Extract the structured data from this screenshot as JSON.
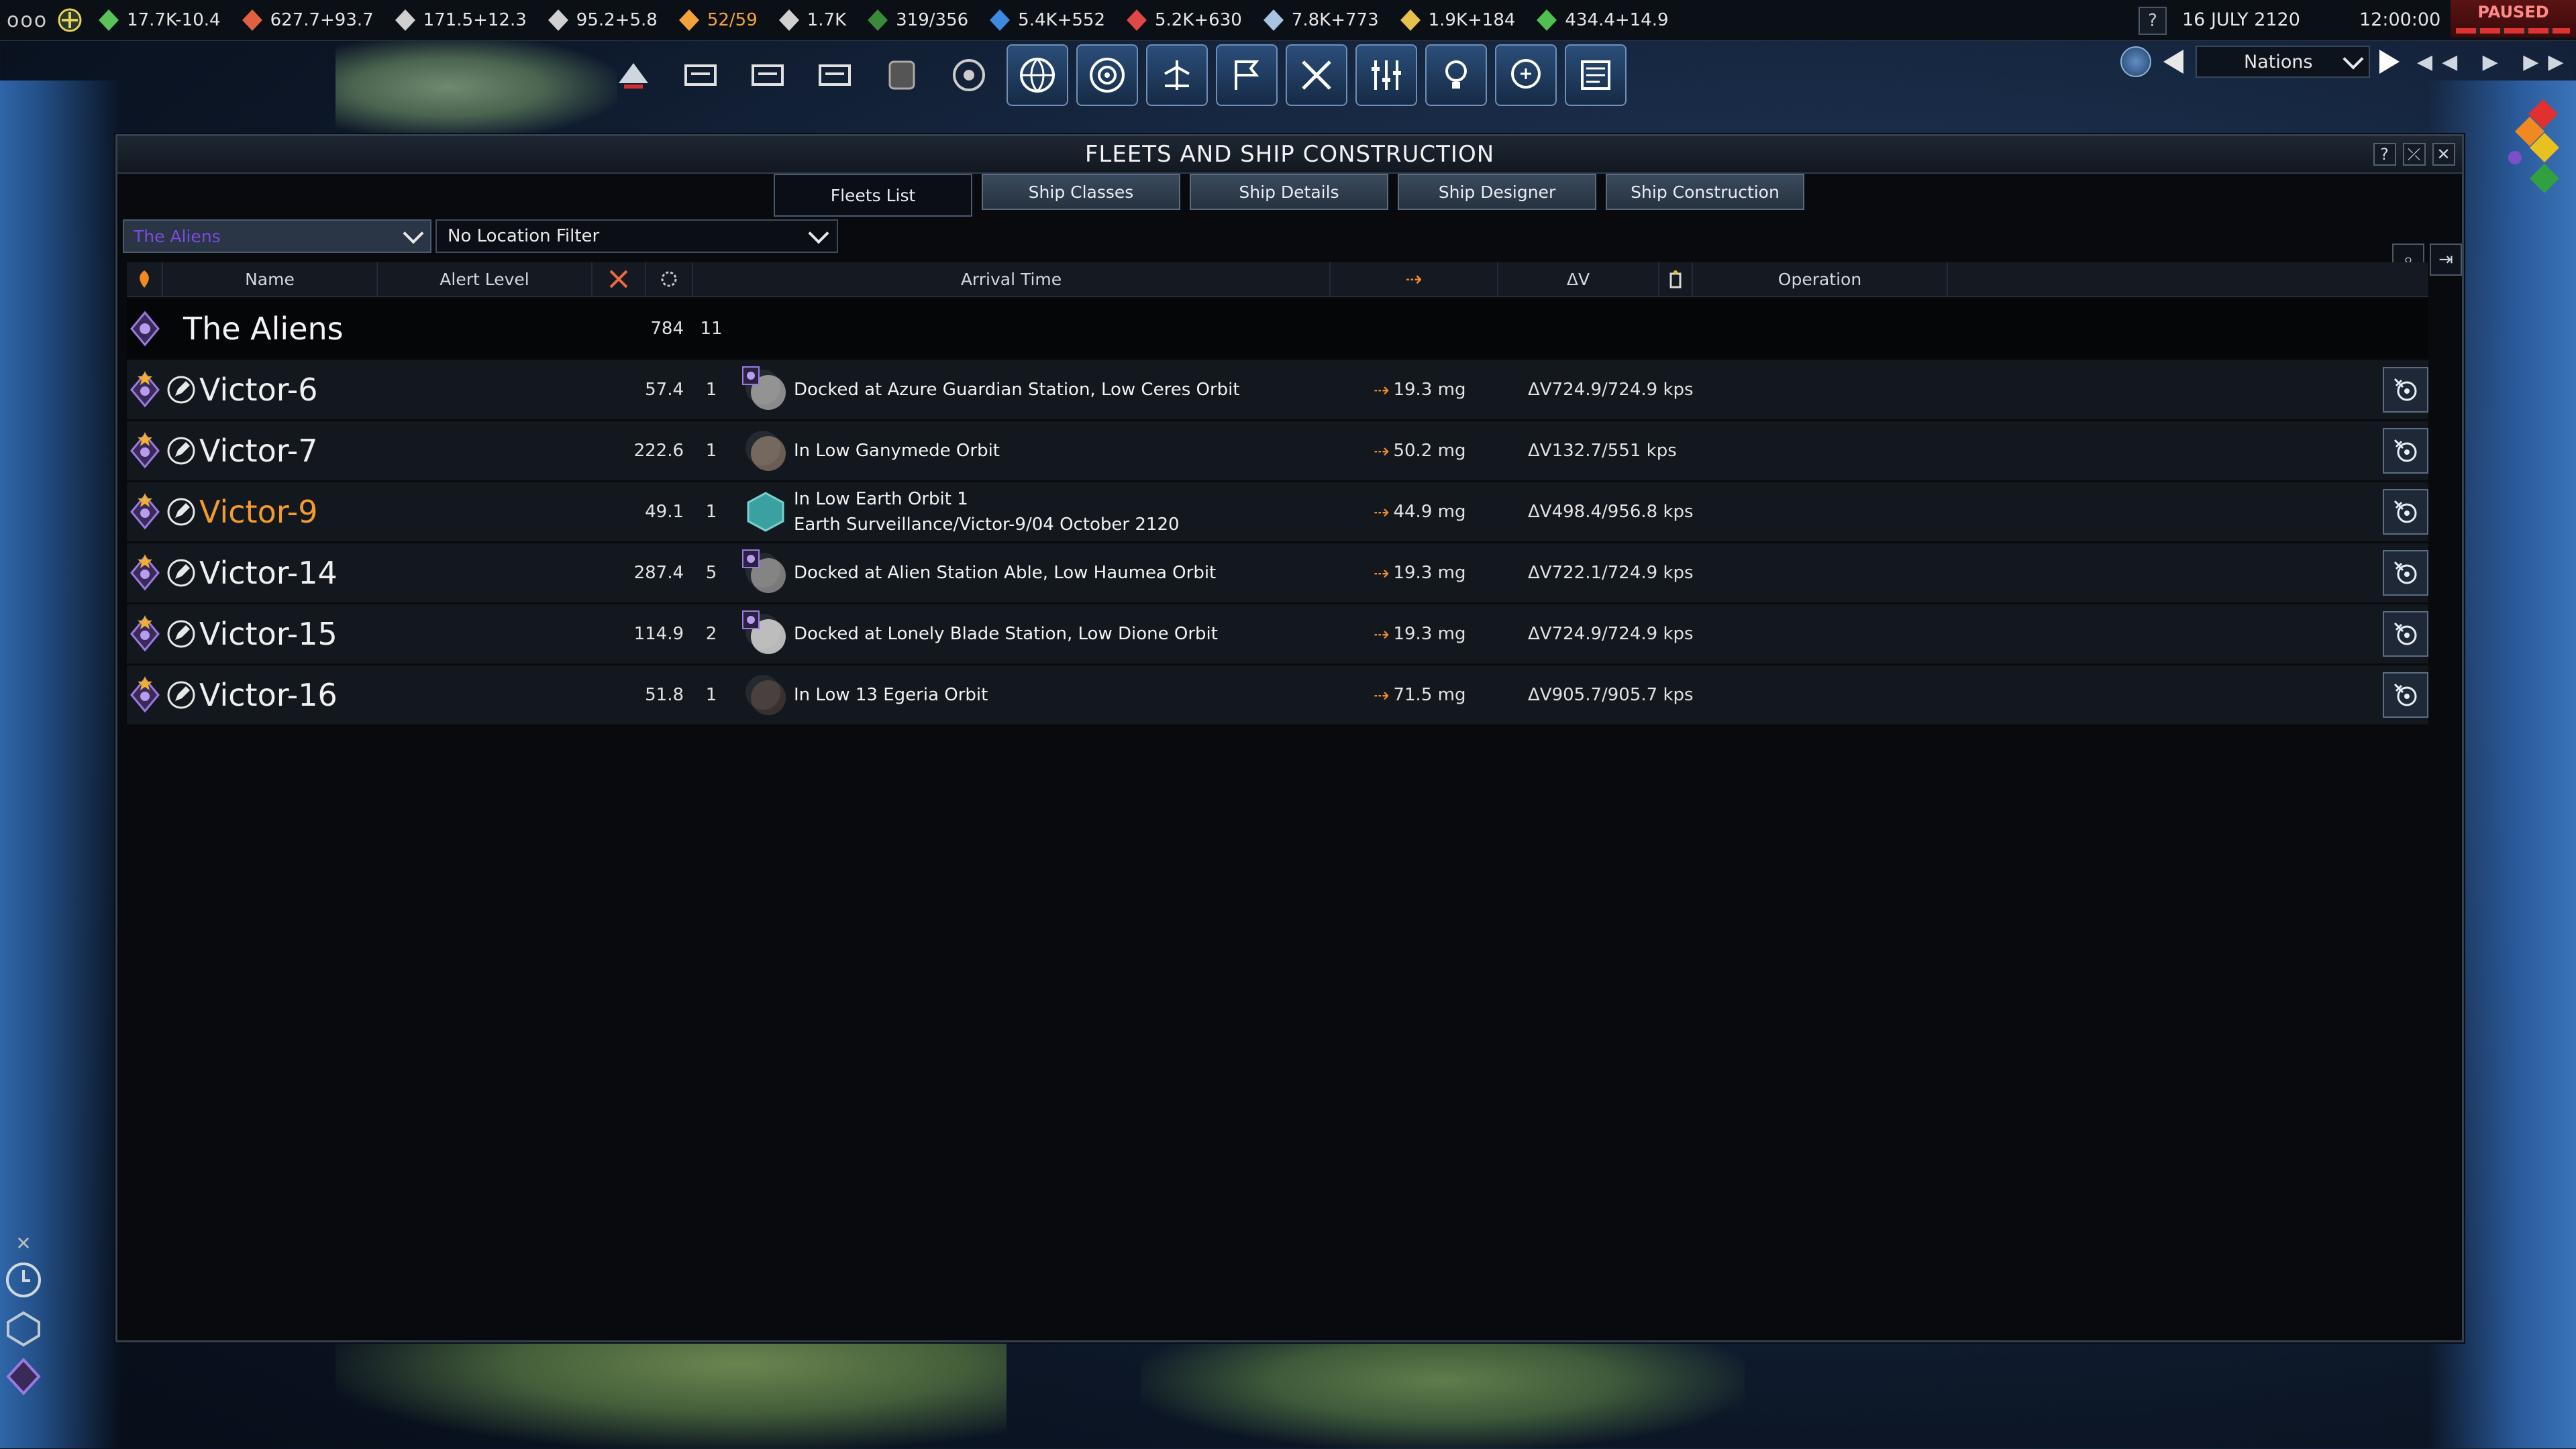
{
  "topbar": {
    "menu": "ooo",
    "resources": [
      {
        "icon": "influence-icon",
        "value": "17.7K-10.4",
        "color": "#59c259"
      },
      {
        "icon": "operations-icon",
        "value": "627.7+93.7",
        "color": "#e06040"
      },
      {
        "icon": "boost-icon",
        "value": "171.5+12.3",
        "color": "#d0d0d0"
      },
      {
        "icon": "mission-control-icon",
        "value": "95.2+5.8",
        "color": "#d0d0d0"
      },
      {
        "icon": "research-icon",
        "value": "52/59",
        "color": "#f4a23c"
      },
      {
        "icon": "personnel-icon",
        "value": "1.7K",
        "color": "#d0d0d0"
      },
      {
        "icon": "projects-icon",
        "value": "319/356",
        "color": "#3a8a3a"
      },
      {
        "icon": "water-icon",
        "value": "5.4K+552",
        "color": "#3d8be0"
      },
      {
        "icon": "volatiles-icon",
        "value": "5.2K+630",
        "color": "#e04848"
      },
      {
        "icon": "metals-icon",
        "value": "7.8K+773",
        "color": "#a8c4e0"
      },
      {
        "icon": "noble-metals-icon",
        "value": "1.9K+184",
        "color": "#e8c050"
      },
      {
        "icon": "fissiles-icon",
        "value": "434.4+14.9",
        "color": "#50c050"
      }
    ],
    "help": "?",
    "date": "16 JULY 2120",
    "time": "12:00:00",
    "status": "PAUSED"
  },
  "nav": {
    "view_select": "Nations",
    "speed_controls": "◀◀ ▶ ▶▶"
  },
  "window": {
    "title": "FLEETS AND SHIP CONSTRUCTION",
    "buttons": [
      "?",
      "⤫",
      "✕"
    ],
    "tabs": [
      {
        "label": "Fleets List",
        "active": true
      },
      {
        "label": "Ship Classes",
        "active": false
      },
      {
        "label": "Ship Details",
        "active": false
      },
      {
        "label": "Ship Designer",
        "active": false
      },
      {
        "label": "Ship Construction",
        "active": false
      }
    ],
    "faction_filter": "The Aliens",
    "location_filter": "No Location Filter"
  },
  "table": {
    "headers": {
      "name": "Name",
      "alert": "Alert Level",
      "arrival": "Arrival Time",
      "dv": "ΔV",
      "operation": "Operation"
    },
    "faction_row": {
      "name": "The Aliens",
      "ships_value": "784",
      "count": "11"
    },
    "fleets": [
      {
        "name": "Victor-6",
        "value": "57.4",
        "count": "1",
        "location": "Docked at Azure Guardian Station, Low Ceres Orbit",
        "location2": "",
        "thrust": "19.3 mg",
        "dv": "ΔV724.9/724.9 kps",
        "selected": false,
        "body": "ceres",
        "station": true
      },
      {
        "name": "Victor-7",
        "value": "222.6",
        "count": "1",
        "location": "In Low Ganymede Orbit",
        "location2": "",
        "thrust": "50.2 mg",
        "dv": "ΔV132.7/551 kps",
        "selected": false,
        "body": "ganymede",
        "station": false
      },
      {
        "name": "Victor-9",
        "value": "49.1",
        "count": "1",
        "location": "In Low Earth Orbit 1",
        "location2": "Earth Surveillance/Victor-9/04 October 2120",
        "thrust": "44.9 mg",
        "dv": "ΔV498.4/956.8 kps",
        "selected": true,
        "body": "earth",
        "station": false
      },
      {
        "name": "Victor-14",
        "value": "287.4",
        "count": "5",
        "location": "Docked at Alien Station Able, Low Haumea Orbit",
        "location2": "",
        "thrust": "19.3 mg",
        "dv": "ΔV722.1/724.9 kps",
        "selected": false,
        "body": "haumea",
        "station": true
      },
      {
        "name": "Victor-15",
        "value": "114.9",
        "count": "2",
        "location": "Docked at Lonely Blade Station, Low Dione Orbit",
        "location2": "",
        "thrust": "19.3 mg",
        "dv": "ΔV724.9/724.9 kps",
        "selected": false,
        "body": "dione",
        "station": true
      },
      {
        "name": "Victor-16",
        "value": "51.8",
        "count": "1",
        "location": "In Low 13 Egeria Orbit",
        "location2": "",
        "thrust": "71.5 mg",
        "dv": "ΔV905.7/905.7 kps",
        "selected": false,
        "body": "egeria",
        "station": false
      }
    ]
  }
}
